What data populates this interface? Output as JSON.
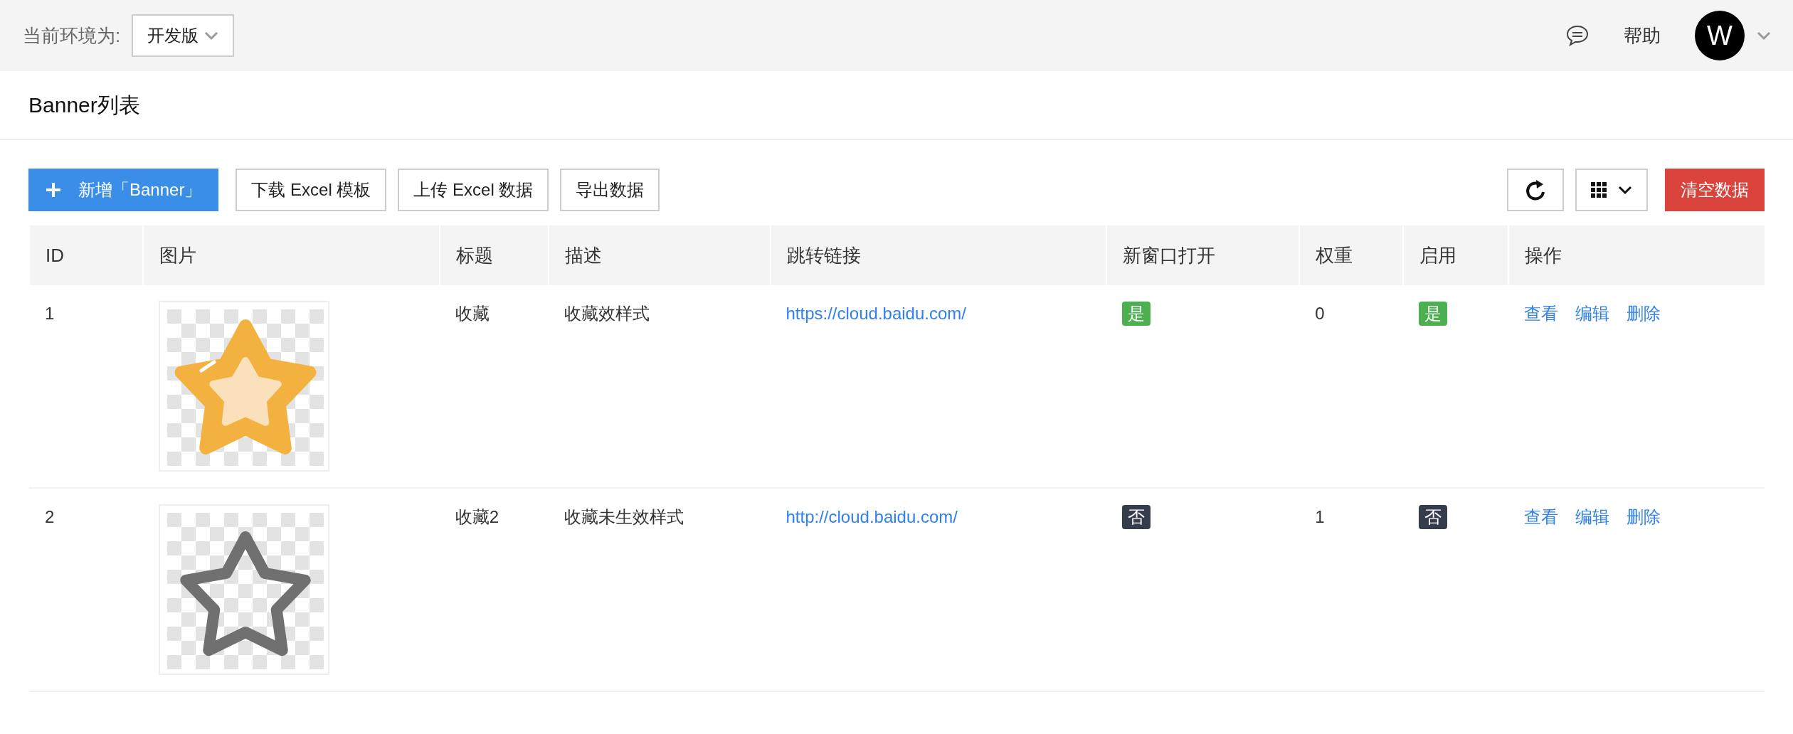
{
  "topbar": {
    "env_label": "当前环境为:",
    "env_value": "开发版",
    "help": "帮助",
    "avatar": "W"
  },
  "page_title": "Banner列表",
  "toolbar": {
    "add": "新增「Banner」",
    "buttons": [
      "下载 Excel 模板",
      "上传 Excel 数据",
      "导出数据"
    ],
    "clear": "清空数据"
  },
  "table": {
    "columns": [
      "ID",
      "图片",
      "标题",
      "描述",
      "跳转链接",
      "新窗口打开",
      "权重",
      "启用",
      "操作"
    ],
    "rows": [
      {
        "id": "1",
        "image": {
          "kind": "filled"
        },
        "title": "收藏",
        "description": "收藏效样式",
        "link": "https://cloud.baidu.com/",
        "new_window": {
          "label": "是",
          "on": true
        },
        "weight": "0",
        "enabled": {
          "label": "是",
          "on": true
        },
        "actions": [
          "查看",
          "编辑",
          "删除"
        ]
      },
      {
        "id": "2",
        "image": {
          "kind": "outline"
        },
        "title": "收藏2",
        "description": "收藏未生效样式",
        "link": "http://cloud.baidu.com/",
        "new_window": {
          "label": "否",
          "on": false
        },
        "weight": "1",
        "enabled": {
          "label": "否",
          "on": false
        },
        "actions": [
          "查看",
          "编辑",
          "删除"
        ]
      }
    ]
  }
}
